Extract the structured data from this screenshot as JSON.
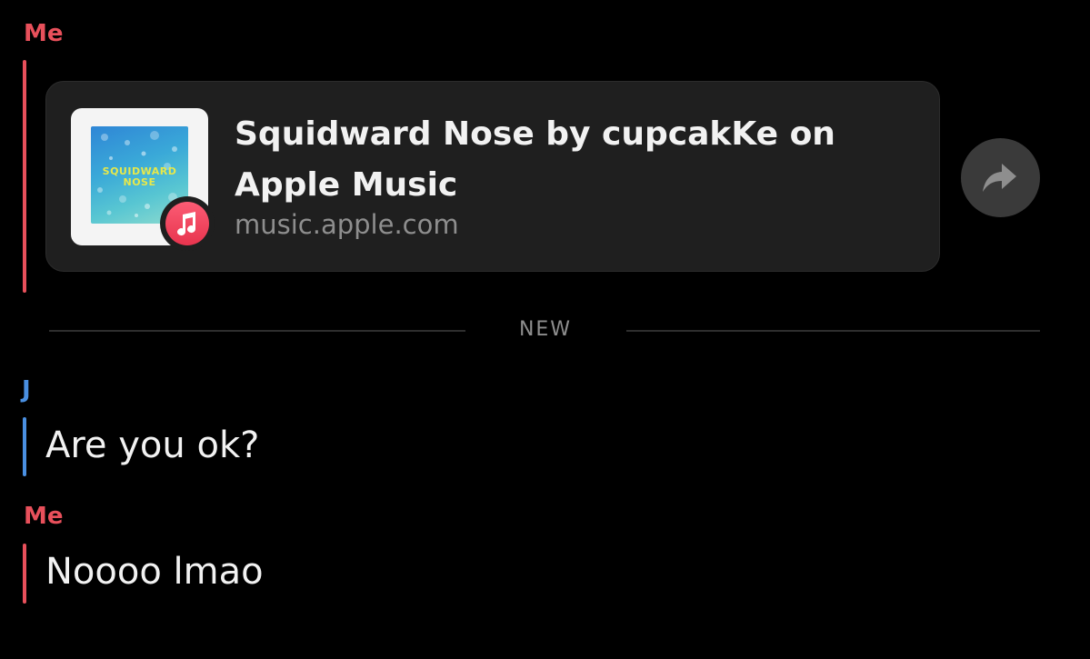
{
  "messages": [
    {
      "sender": "Me",
      "link": {
        "title_line1": "Squidward Nose by cupcakKe on",
        "title_line2": "Apple Music",
        "domain": "music.apple.com",
        "album_art_text_line1": "SQUIDWARD",
        "album_art_text_line2": "NOSE",
        "badge_icon": "music-note-icon"
      }
    },
    {
      "sender": "J",
      "text": "Are you ok?"
    },
    {
      "sender": "Me",
      "text": "Noooo lmao"
    }
  ],
  "divider": {
    "label": "NEW"
  },
  "share_icon": "share-arrow-icon",
  "colors": {
    "me": "#e8505b",
    "them": "#4a90e2",
    "background": "#000000",
    "card": "#1f1f1f"
  }
}
